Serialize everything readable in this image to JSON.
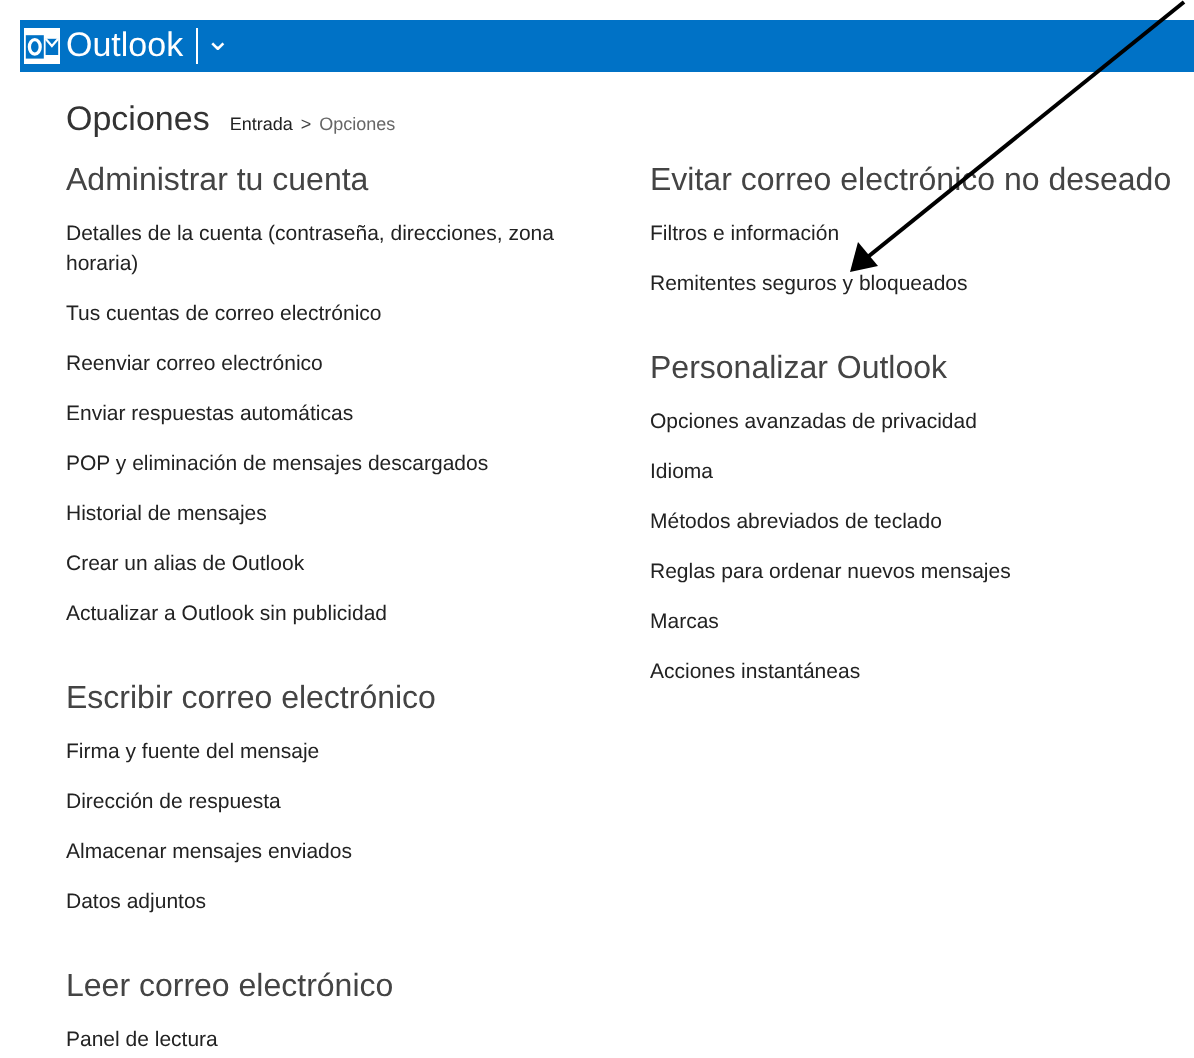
{
  "header": {
    "app_name": "Outlook",
    "menu_glyph": "⌄"
  },
  "page": {
    "title": "Opciones",
    "breadcrumb": [
      {
        "label": "Entrada",
        "current": false
      },
      {
        "label": "Opciones",
        "current": true
      }
    ],
    "breadcrumb_separator": ">"
  },
  "columns": [
    {
      "sections": [
        {
          "heading": "Administrar tu cuenta",
          "links": [
            "Detalles de la cuenta (contraseña, direcciones, zona horaria)",
            "Tus cuentas de correo electrónico",
            "Reenviar correo electrónico",
            "Enviar respuestas automáticas",
            "POP y eliminación de mensajes descargados",
            "Historial de mensajes",
            "Crear un alias de Outlook",
            "Actualizar a Outlook sin publicidad"
          ]
        },
        {
          "heading": "Escribir correo electrónico",
          "links": [
            "Firma y fuente del mensaje",
            "Dirección de respuesta",
            "Almacenar mensajes enviados",
            "Datos adjuntos"
          ]
        },
        {
          "heading": "Leer correo electrónico",
          "links": [
            "Panel de lectura"
          ]
        }
      ]
    },
    {
      "sections": [
        {
          "heading": "Evitar correo electrónico no deseado",
          "links": [
            "Filtros e información",
            "Remitentes seguros y bloqueados"
          ]
        },
        {
          "heading": "Personalizar Outlook",
          "links": [
            "Opciones avanzadas de privacidad",
            "Idioma",
            "Métodos abreviados de teclado",
            "Reglas para ordenar nuevos mensajes",
            "Marcas",
            "Acciones instantáneas"
          ]
        }
      ]
    }
  ],
  "annotation": {
    "kind": "arrow"
  }
}
